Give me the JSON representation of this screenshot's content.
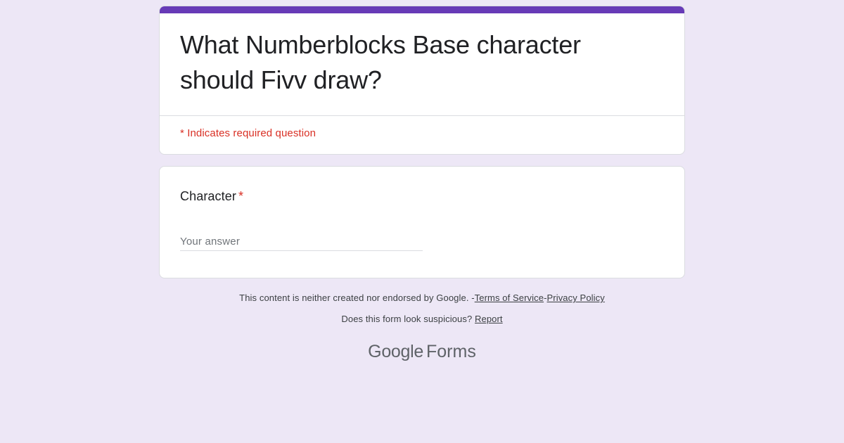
{
  "form": {
    "title": "What Numberblocks Base character should Fivv draw?",
    "required_note": "* Indicates required question"
  },
  "question": {
    "label": "Character",
    "required_mark": "*",
    "placeholder": "Your answer",
    "value": ""
  },
  "footer": {
    "disclaimer": "This content is neither created nor endorsed by Google. -",
    "terms_label": "Terms of Service",
    "separator": "-",
    "privacy_label": "Privacy Policy",
    "suspicious_text": "Does this form look suspicious?",
    "report_label": "Report"
  },
  "brand": {
    "google": "Google",
    "forms": "Forms"
  },
  "colors": {
    "background": "#ede7f6",
    "accent": "#673ab7",
    "required": "#d93025"
  }
}
